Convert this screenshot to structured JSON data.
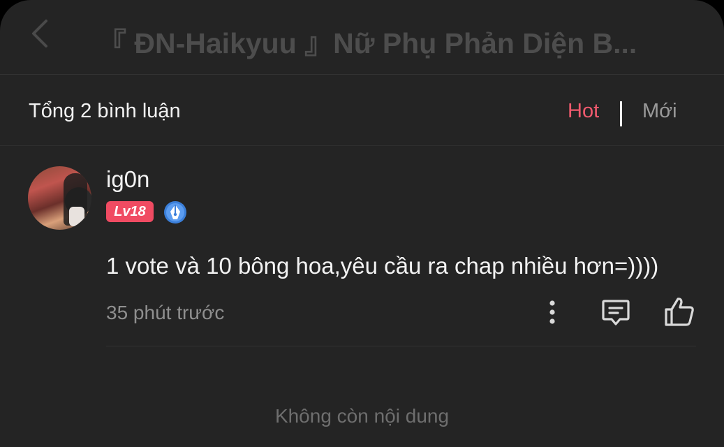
{
  "header": {
    "title": "『 ĐN-Haikyuu 』Nữ Phụ Phản Diện B...",
    "back_icon": "chevron-left-icon"
  },
  "summary": {
    "total": "Tổng 2 bình luận",
    "sort_hot": "Hot",
    "sort_new": "Mới",
    "accent_color": "#f05a6e"
  },
  "comment": {
    "username": "ig0n",
    "level": "Lv18",
    "badge_icon": "pen-badge-icon",
    "text": "1 vote và 10 bông hoa,yêu cầu ra chap nhiều hơn=))))",
    "time": "35 phút trước",
    "actions": [
      "more-icon",
      "reply-icon",
      "like-icon"
    ]
  },
  "footer": {
    "end_text": "Không còn nội dung"
  }
}
